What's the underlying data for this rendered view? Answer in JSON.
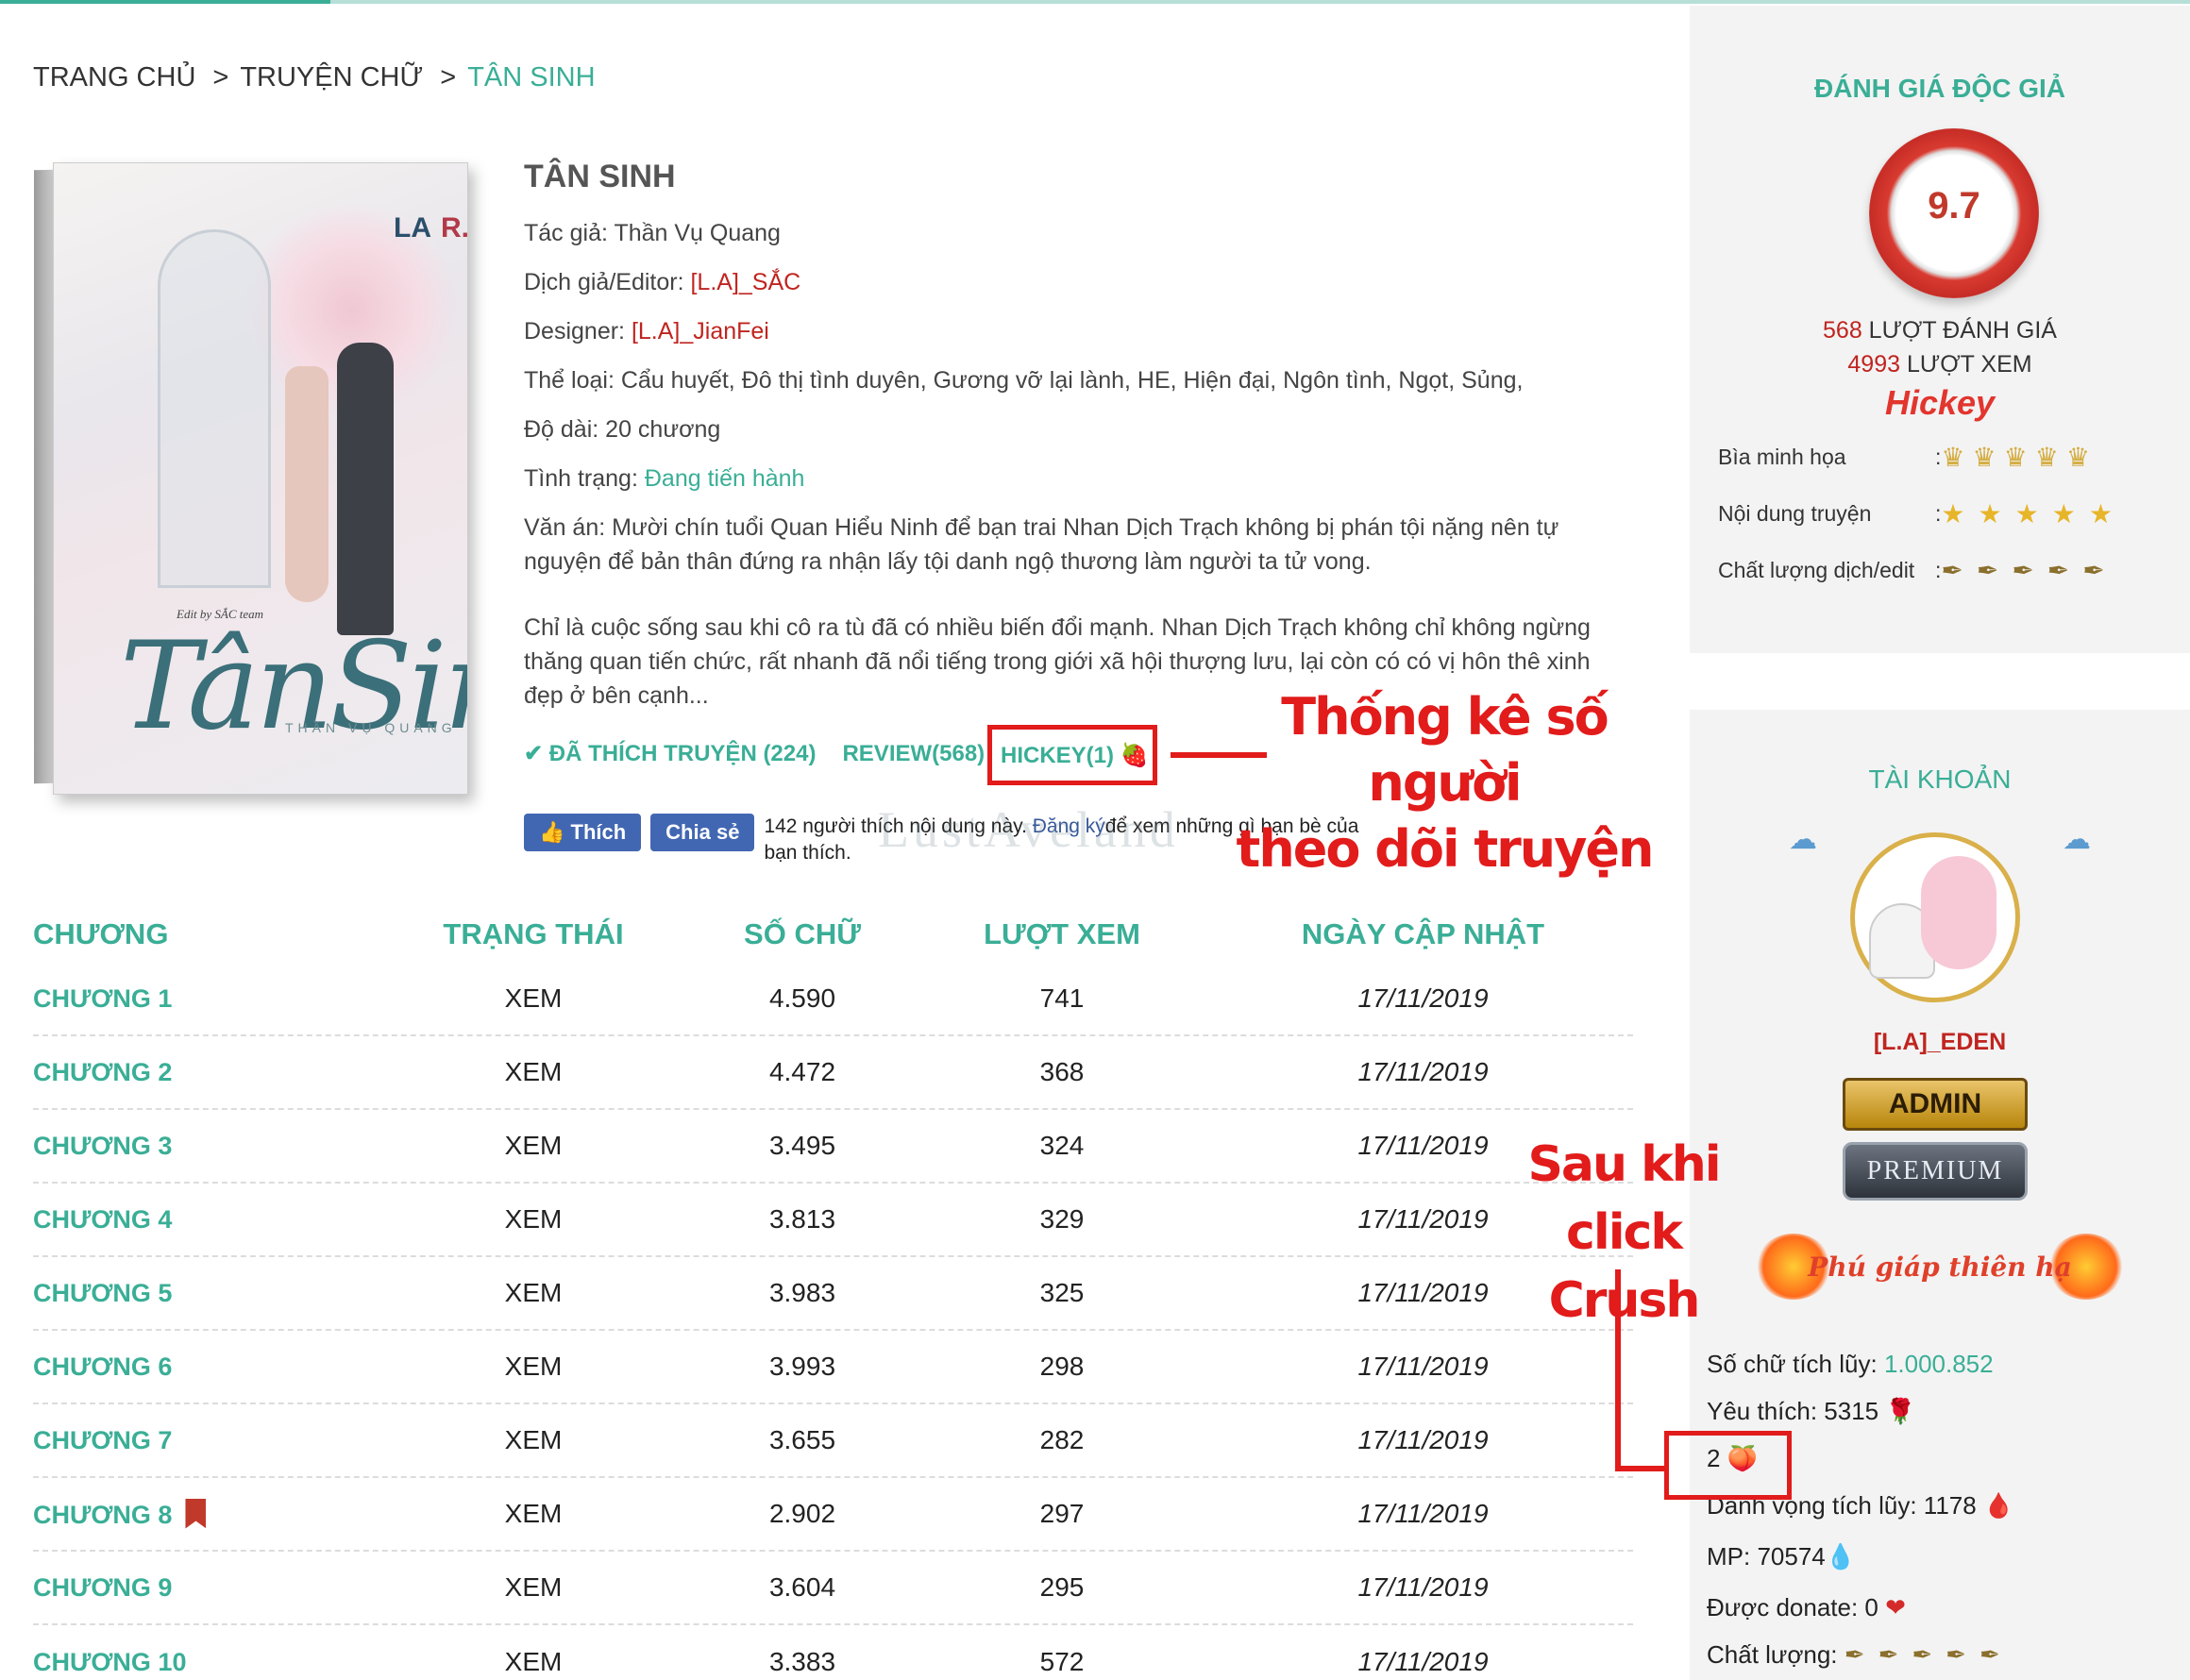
{
  "breadcrumb": {
    "home": "TRANG CHỦ",
    "sep": ">",
    "category": "TRUYỆN CHỮ",
    "current": "TÂN SINH"
  },
  "cover": {
    "edit_by": "Edit by SẮC team",
    "title": "TânSinh",
    "author": "THẦN VỤ QUANG",
    "logo_a": "LA",
    "logo_b": "R."
  },
  "book": {
    "title": "TÂN SINH",
    "author_label": "Tác giả:",
    "author": "Thần Vụ Quang",
    "translator_label": "Dịch giả/Editor:",
    "translator": "[L.A]_SẮC",
    "designer_label": "Designer:",
    "designer": "[L.A]_JianFei",
    "genre_label": "Thể loại:",
    "genre": "Cẩu huyết, Đô thị tình duyên, Gương vỡ lại lành, HE, Hiện đại, Ngôn tình, Ngọt, Sủng,",
    "length_label": "Độ dài:",
    "length": "20 chương",
    "status_label": "Tình trạng:",
    "status": "Đang tiến hành",
    "summary_1": "Văn án: Mười chín tuổi Quan Hiểu Ninh để bạn trai Nhan Dịch Trạch không bị phán tội nặng nên tự nguyện để bản thân đứng ra nhận lấy tội danh ngộ thương làm người ta tử vong.",
    "summary_2": "Chỉ là cuộc sống sau khi cô ra tù đã có nhiều biến đổi mạnh. Nhan Dịch Trạch không chỉ không ngừng thăng quan tiến chức, rất nhanh đã nổi tiếng trong giới xã hội thượng lưu, lại còn có có vị hôn thê xinh đẹp ở bên cạnh..."
  },
  "actions": {
    "liked": "✔ ĐÃ THÍCH TRUYỆN (224)",
    "review": "REVIEW(568)",
    "hickey": "HICKEY(1)",
    "strawberry": "🍓"
  },
  "facebook": {
    "like": "👍 Thích",
    "share": "Chia sẻ",
    "text_a": "142 người thích nội dung này. ",
    "link": "Đăng ký",
    "text_b": "để xem những gì bạn bè của bạn thích."
  },
  "watermark": "LustAveland",
  "annotation_1": {
    "line1": "Thống kê số người",
    "line2": "theo dõi truyện"
  },
  "annotation_2": {
    "line1": "Sau khi",
    "line2": "click Crush"
  },
  "table": {
    "headers": [
      "CHƯƠNG",
      "TRẠNG THÁI",
      "SỐ CHỮ",
      "LƯỢT XEM",
      "NGÀY CẬP NHẬT"
    ],
    "rows": [
      {
        "chapter": "CHƯƠNG 1",
        "status": "XEM",
        "words": "4.590",
        "views": "741",
        "date": "17/11/2019"
      },
      {
        "chapter": "CHƯƠNG 2",
        "status": "XEM",
        "words": "4.472",
        "views": "368",
        "date": "17/11/2019"
      },
      {
        "chapter": "CHƯƠNG 3",
        "status": "XEM",
        "words": "3.495",
        "views": "324",
        "date": "17/11/2019"
      },
      {
        "chapter": "CHƯƠNG 4",
        "status": "XEM",
        "words": "3.813",
        "views": "329",
        "date": "17/11/2019"
      },
      {
        "chapter": "CHƯƠNG 5",
        "status": "XEM",
        "words": "3.983",
        "views": "325",
        "date": "17/11/2019"
      },
      {
        "chapter": "CHƯƠNG 6",
        "status": "XEM",
        "words": "3.993",
        "views": "298",
        "date": "17/11/2019"
      },
      {
        "chapter": "CHƯƠNG 7",
        "status": "XEM",
        "words": "3.655",
        "views": "282",
        "date": "17/11/2019"
      },
      {
        "chapter": "CHƯƠNG 8",
        "status": "XEM",
        "words": "2.902",
        "views": "297",
        "date": "17/11/2019"
      },
      {
        "chapter": "CHƯƠNG 9",
        "status": "XEM",
        "words": "3.604",
        "views": "295",
        "date": "17/11/2019"
      },
      {
        "chapter": "CHƯƠNG 10",
        "status": "XEM",
        "words": "3.383",
        "views": "572",
        "date": "17/11/2019"
      }
    ]
  },
  "rating_panel": {
    "title": "ĐÁNH GIÁ ĐỘC GIẢ",
    "score": "9.7",
    "ratings_count": "568",
    "ratings_label": " LƯỢT ĐÁNH GIÁ",
    "views_count": "4993",
    "views_label": " LƯỢT XEM",
    "brand": "Hickey",
    "rows": [
      {
        "label": "Bìa minh họa",
        "icon": "crown-icon",
        "glyph": "♛",
        "count": 5
      },
      {
        "label": "Nội dung truyện",
        "icon": "medal-star-icon",
        "glyph": "★",
        "count": 5
      },
      {
        "label": "Chất lượng dịch/edit",
        "icon": "pen-icon",
        "glyph": "✒",
        "count": 5
      }
    ],
    "colon": ":"
  },
  "account_panel": {
    "title": "TÀI KHOẢN",
    "username": "[L.A]_EDEN",
    "badge_admin": "ADMIN",
    "badge_premium": "PREMIUM",
    "title_badge": "Phú giáp thiên hạ",
    "words_label": "Số chữ tích lũy: ",
    "words_value": "1.000.852",
    "likes_label": "Yêu thích: 5315",
    "likes_icon": "🌹",
    "crush_value": "2",
    "crush_icon": "🍑",
    "fame_label": "Danh vọng tích lũy: 1178",
    "fame_icon": "🩸",
    "mp_label": "MP: 70574",
    "mp_icon": "💧",
    "donate_label": "Được donate: 0",
    "donate_icon": "❤",
    "quality_label": "Chất lượng:",
    "quality_glyph": "✒"
  },
  "colors": {
    "accent": "#3aae96",
    "red": "#c0241f",
    "annotation": "#e21b1b"
  }
}
